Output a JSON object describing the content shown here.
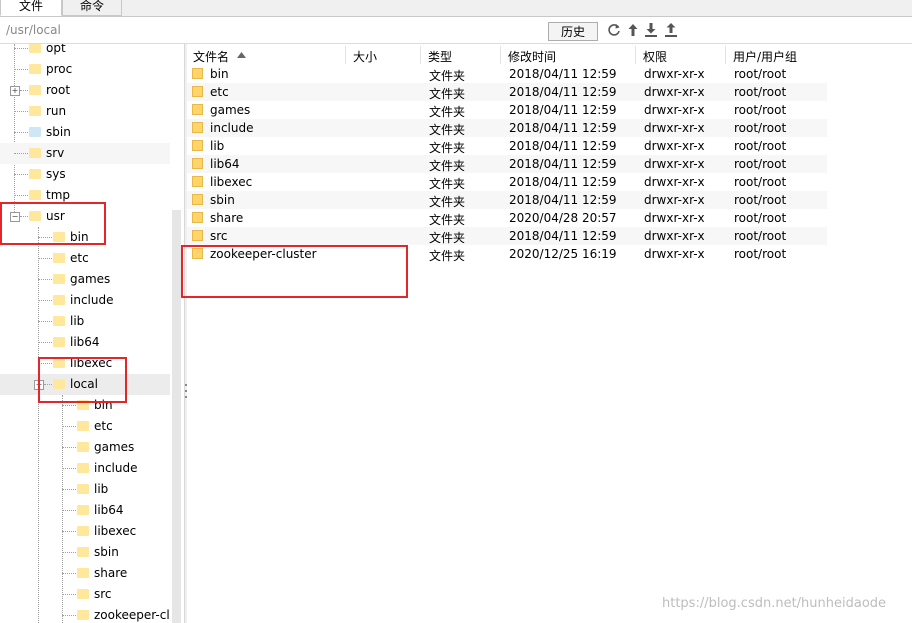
{
  "tabs": [
    "文件",
    "命令"
  ],
  "path": {
    "value": "/usr/local"
  },
  "toolbar": {
    "history_label": "历史"
  },
  "icons": [
    "refresh-icon",
    "up-arrow-icon",
    "download-icon",
    "upload-icon"
  ],
  "tree": {
    "top_items": [
      "opt",
      "proc",
      "root",
      "run",
      "sbin",
      "srv",
      "sys",
      "tmp",
      "usr"
    ],
    "usr_children": [
      "bin",
      "etc",
      "games",
      "include",
      "lib",
      "lib64",
      "libexec",
      "local"
    ],
    "local_children": [
      "bin",
      "etc",
      "games",
      "include",
      "lib",
      "lib64",
      "libexec",
      "sbin",
      "share",
      "src",
      "zookeeper-cl"
    ]
  },
  "list": {
    "columns": [
      "文件名",
      "大小",
      "类型",
      "修改时间",
      "权限",
      "用户/用户组"
    ],
    "rows": [
      {
        "name": "bin",
        "size": "",
        "type": "文件夹",
        "mtime": "2018/04/11 12:59",
        "perm": "drwxr-xr-x",
        "owner": "root/root"
      },
      {
        "name": "etc",
        "size": "",
        "type": "文件夹",
        "mtime": "2018/04/11 12:59",
        "perm": "drwxr-xr-x",
        "owner": "root/root"
      },
      {
        "name": "games",
        "size": "",
        "type": "文件夹",
        "mtime": "2018/04/11 12:59",
        "perm": "drwxr-xr-x",
        "owner": "root/root"
      },
      {
        "name": "include",
        "size": "",
        "type": "文件夹",
        "mtime": "2018/04/11 12:59",
        "perm": "drwxr-xr-x",
        "owner": "root/root"
      },
      {
        "name": "lib",
        "size": "",
        "type": "文件夹",
        "mtime": "2018/04/11 12:59",
        "perm": "drwxr-xr-x",
        "owner": "root/root"
      },
      {
        "name": "lib64",
        "size": "",
        "type": "文件夹",
        "mtime": "2018/04/11 12:59",
        "perm": "drwxr-xr-x",
        "owner": "root/root"
      },
      {
        "name": "libexec",
        "size": "",
        "type": "文件夹",
        "mtime": "2018/04/11 12:59",
        "perm": "drwxr-xr-x",
        "owner": "root/root"
      },
      {
        "name": "sbin",
        "size": "",
        "type": "文件夹",
        "mtime": "2018/04/11 12:59",
        "perm": "drwxr-xr-x",
        "owner": "root/root"
      },
      {
        "name": "share",
        "size": "",
        "type": "文件夹",
        "mtime": "2020/04/28 20:57",
        "perm": "drwxr-xr-x",
        "owner": "root/root"
      },
      {
        "name": "src",
        "size": "",
        "type": "文件夹",
        "mtime": "2018/04/11 12:59",
        "perm": "drwxr-xr-x",
        "owner": "root/root"
      },
      {
        "name": "zookeeper-cluster",
        "size": "",
        "type": "文件夹",
        "mtime": "2020/12/25 16:19",
        "perm": "drwxr-xr-x",
        "owner": "root/root"
      }
    ]
  },
  "watermark": "https://blog.csdn.net/hunheidaode",
  "colors": {
    "annotation": "#e3262a",
    "folder": "#ffd56a",
    "selected_row": "#ececec"
  }
}
